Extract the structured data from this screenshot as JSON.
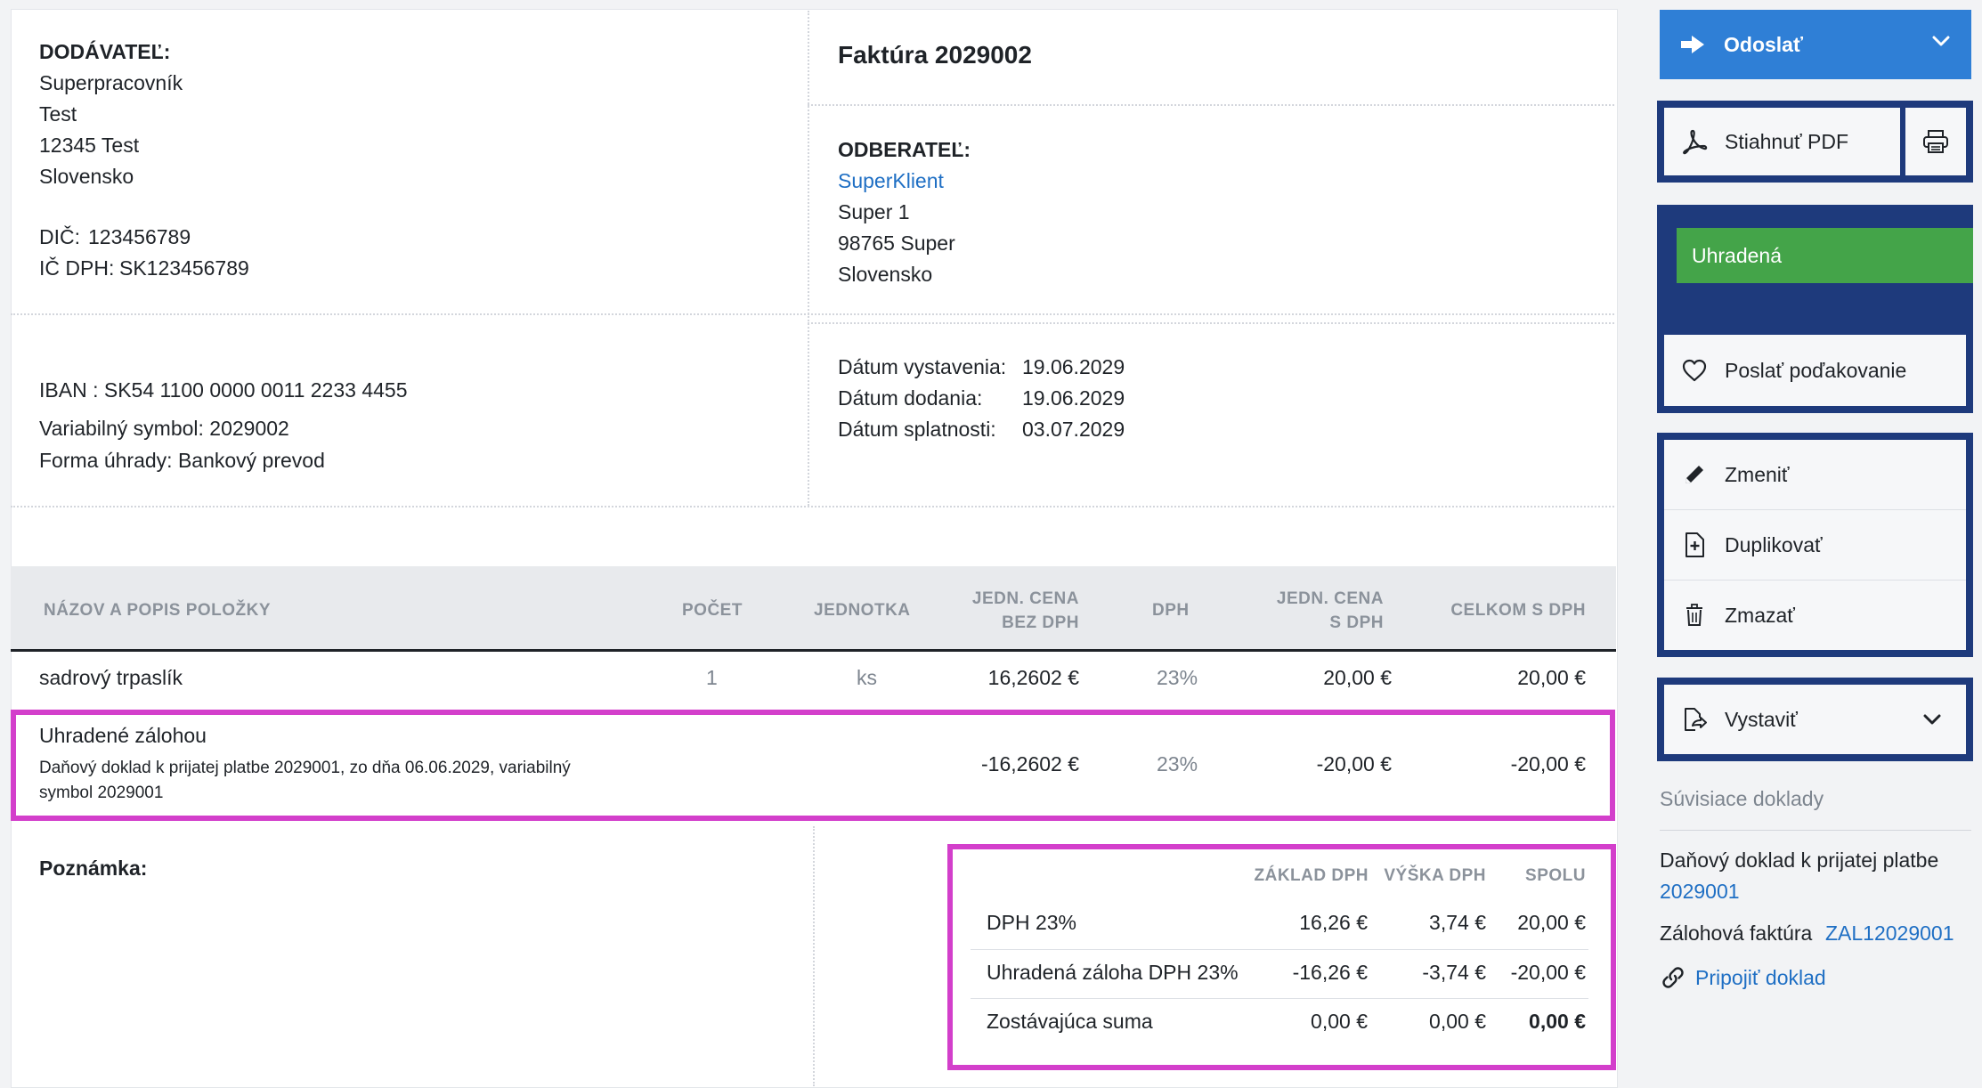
{
  "supplier": {
    "label": "DODÁVATEĽ:",
    "name": "Superpracovník",
    "line2": "Test",
    "city": "12345 Test",
    "country": "Slovensko",
    "dic_label": "DIČ:",
    "dic": "123456789",
    "icdph_label": "IČ DPH:",
    "icdph": "SK123456789"
  },
  "invoice": {
    "title": "Faktúra 2029002"
  },
  "customer": {
    "label": "ODBERATEĽ:",
    "name": "SuperKlient",
    "line2": "Super 1",
    "city": "98765 Super",
    "country": "Slovensko"
  },
  "payment": {
    "iban": "IBAN : SK54 1100 0000 0011 2233 4455",
    "variable_symbol": "Variabilný symbol: 2029002",
    "method": "Forma úhrady: Bankový prevod"
  },
  "dates": {
    "issued_label": "Dátum vystavenia:",
    "issued": "19.06.2029",
    "delivered_label": "Dátum dodania:",
    "delivered": "19.06.2029",
    "due_label": "Dátum splatnosti:",
    "due": "03.07.2029"
  },
  "items_table": {
    "headers": {
      "name": "NÁZOV A POPIS POLOŽKY",
      "qty": "POČET",
      "unit": "JEDNOTKA",
      "unit_price_1": "JEDN. CENA",
      "unit_price_2": "BEZ DPH",
      "vat": "DPH",
      "unit_price_vat_1": "JEDN. CENA",
      "unit_price_vat_2": "S DPH",
      "total": "CELKOM S DPH"
    },
    "rows": [
      {
        "name": "sadrový trpaslík",
        "qty": "1",
        "unit": "ks",
        "unit_price": "16,2602 €",
        "vat": "23%",
        "unit_price_vat": "20,00 €",
        "total": "20,00 €"
      },
      {
        "name": "Uhradené zálohou",
        "desc_line1": "Daňový doklad k prijatej platbe 2029001, zo dňa 06.06.2029, variabilný",
        "desc_line2": "symbol 2029001",
        "unit_price": "-16,2602 €",
        "vat": "23%",
        "unit_price_vat": "-20,00 €",
        "total": "-20,00 €"
      }
    ]
  },
  "note": {
    "label": "Poznámka:"
  },
  "vat_summary": {
    "headers": {
      "base": "ZÁKLAD DPH",
      "vat": "VÝŠKA DPH",
      "total": "SPOLU"
    },
    "rows": [
      {
        "label": "DPH 23%",
        "base": "16,26 €",
        "vat": "3,74 €",
        "total": "20,00 €"
      },
      {
        "label": "Uhradená záloha DPH 23%",
        "base": "-16,26 €",
        "vat": "-3,74 €",
        "total": "-20,00 €"
      },
      {
        "label": "Zostávajúca suma",
        "base": "0,00 €",
        "vat": "0,00 €",
        "total": "0,00 €"
      }
    ]
  },
  "sidebar": {
    "send_label": "Odoslať",
    "download_pdf_label": "Stiahnuť PDF",
    "status_label": "Uhradená",
    "thanks_label": "Poslať poďakovanie",
    "edit_label": "Zmeniť",
    "duplicate_label": "Duplikovať",
    "delete_label": "Zmazať",
    "issue_label": "Vystaviť",
    "related_title": "Súvisiace doklady",
    "related": [
      {
        "text": "Daňový doklad k prijatej platbe",
        "link": "2029001"
      },
      {
        "text": "Zálohová faktúra",
        "link": "ZAL12029001"
      }
    ],
    "attach_label": "Pripojiť doklad"
  },
  "colors": {
    "primary_blue": "#2f7fd6",
    "panel_navy": "#1e3a7c",
    "status_green": "#44a449",
    "highlight_magenta": "#d33fcb",
    "link_blue": "#1f6fc4"
  }
}
